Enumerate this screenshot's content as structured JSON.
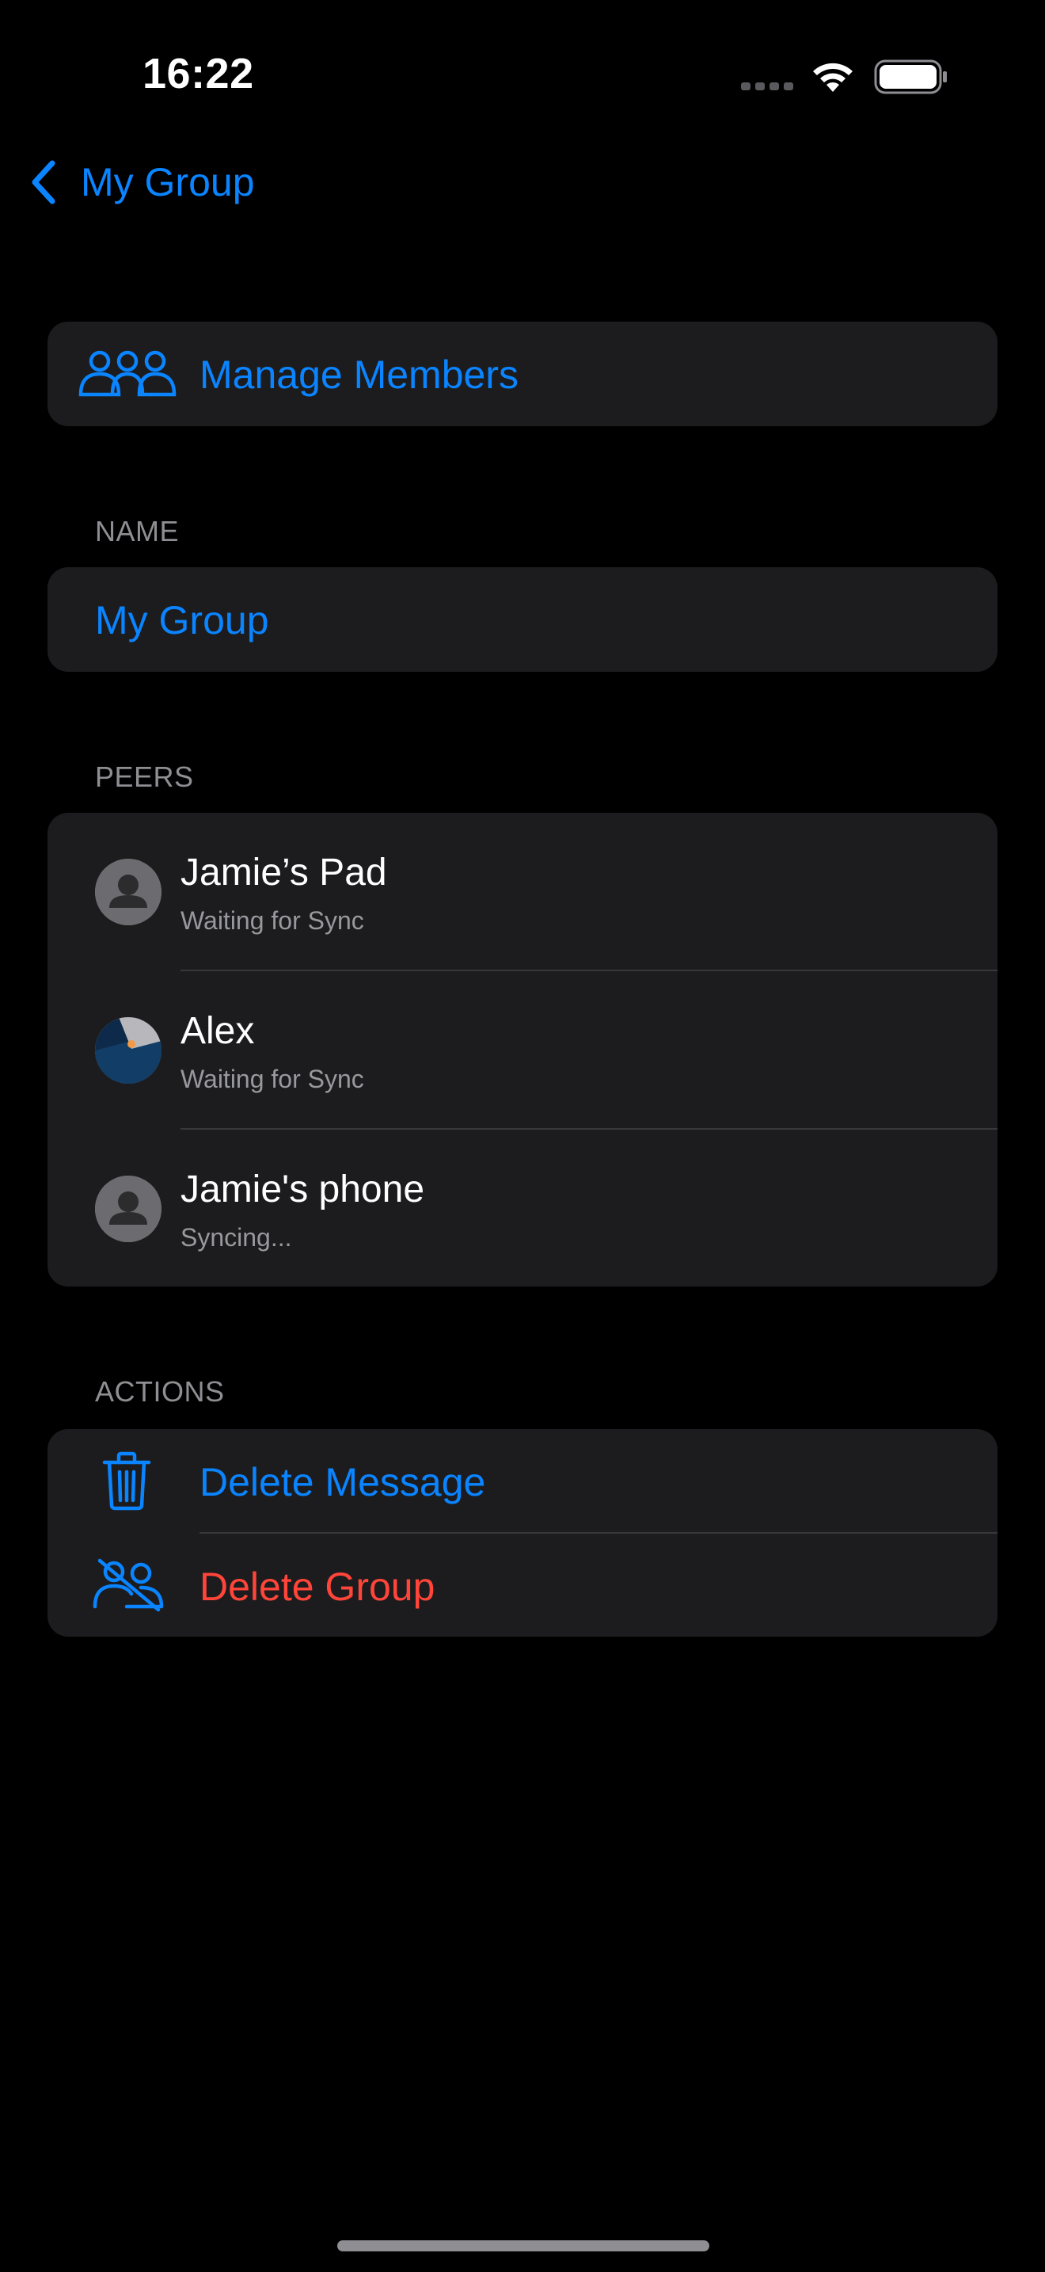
{
  "status_bar": {
    "time": "16:22"
  },
  "nav": {
    "back_label": "My Group"
  },
  "manage": {
    "label": "Manage Members"
  },
  "name_section": {
    "header": "NAME",
    "value": "My Group"
  },
  "peers_section": {
    "header": "PEERS",
    "items": [
      {
        "name": "Jamie’s Pad",
        "status": "Waiting for Sync",
        "avatar": "person-placeholder"
      },
      {
        "name": "Alex",
        "status": "Waiting for Sync",
        "avatar": "photo"
      },
      {
        "name": "Jamie's phone",
        "status": "Syncing...",
        "avatar": "person-placeholder"
      }
    ]
  },
  "actions_section": {
    "header": "ACTIONS",
    "delete_message": "Delete Message",
    "delete_group": "Delete Group"
  },
  "colors": {
    "accent": "#0a84ff",
    "destructive": "#ff453a",
    "card": "#1c1c1e",
    "background": "#000000"
  }
}
